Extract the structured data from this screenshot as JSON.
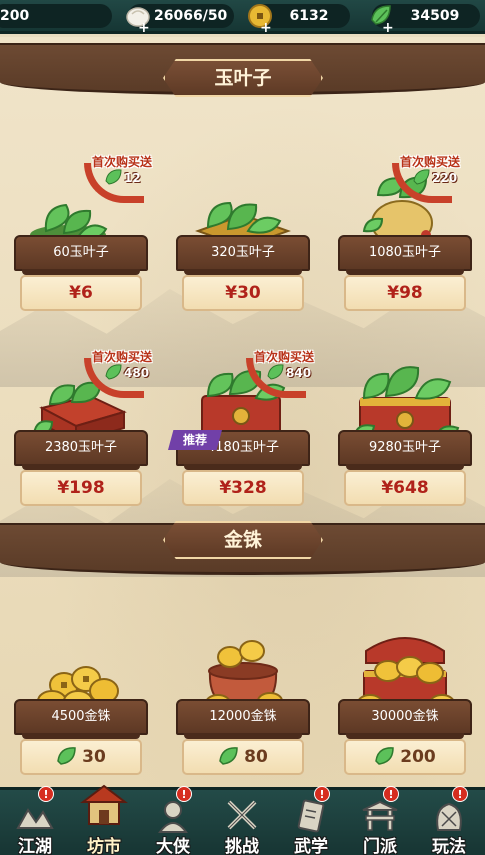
{
  "resources": [
    {
      "name": "stamina",
      "value": "200",
      "icon": "partial-icon"
    },
    {
      "name": "bun",
      "value": "26066/50",
      "icon": "steamed-bun-icon"
    },
    {
      "name": "coin",
      "value": "6132",
      "icon": "copper-coin-icon"
    },
    {
      "name": "jade-leaf",
      "value": "34509",
      "icon": "jade-leaf-icon"
    }
  ],
  "sections": {
    "jade": {
      "title": "玉叶子"
    },
    "gold": {
      "title": "金铢"
    }
  },
  "jade_items": [
    {
      "name": "60玉叶子",
      "price": "¥6",
      "bonus_label": "首次购买送",
      "bonus_count": "12"
    },
    {
      "name": "320玉叶子",
      "price": "¥30"
    },
    {
      "name": "1080玉叶子",
      "price": "¥98",
      "bonus_label": "首次购买送",
      "bonus_count": "220"
    },
    {
      "name": "2380玉叶子",
      "price": "¥198",
      "bonus_label": "首次购买送",
      "bonus_count": "480"
    },
    {
      "name": "4180玉叶子",
      "price": "¥328",
      "bonus_label": "首次购买送",
      "bonus_count": "840",
      "tag": "推荐"
    },
    {
      "name": "9280玉叶子",
      "price": "¥648"
    }
  ],
  "gold_items": [
    {
      "name": "4500金铢",
      "price": "30"
    },
    {
      "name": "12000金铢",
      "price": "80"
    },
    {
      "name": "30000金铢",
      "price": "200"
    }
  ],
  "nav": [
    {
      "label": "江湖",
      "badge": "!"
    },
    {
      "label": "坊市",
      "active": true
    },
    {
      "label": "大侠",
      "badge": "!"
    },
    {
      "label": "挑战"
    },
    {
      "label": "武学",
      "badge": "!"
    },
    {
      "label": "门派",
      "badge": "!"
    },
    {
      "label": "玩法",
      "badge": "!"
    }
  ],
  "colors": {
    "price_red": "#b0221a",
    "jade_green": "#4caf50",
    "wood_brown": "#6d4a33",
    "nav_teal": "#1d403d"
  }
}
